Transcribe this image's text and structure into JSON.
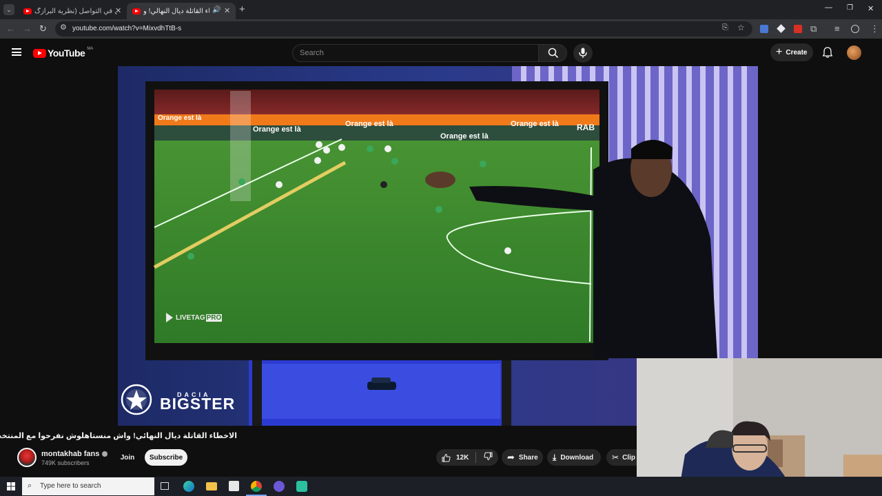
{
  "browser": {
    "tabs": [
      {
        "title": "مشكل في التواصل (نظرية البرازگ...",
        "active": false
      },
      {
        "title": "الاخطاء القاتلة ديال النهالي! و...",
        "active": true
      }
    ],
    "new_tab_label": "+",
    "url": "youtube.com/watch?v=MixvdhTtB-s",
    "window_controls": {
      "minimize": "—",
      "restore": "❐",
      "close": "✕"
    }
  },
  "youtube": {
    "logo_text": "YouTube",
    "region": "MA",
    "search_placeholder": "Search",
    "create_label": "Create"
  },
  "video": {
    "stadium_ads": [
      "Orange est là",
      "Orange est là",
      "Orange est là",
      "Orange est là",
      "Orange est là"
    ],
    "ad_short": "RAB",
    "watermark": "LIVETAG",
    "watermark_suffix": "PRO",
    "brand_small": "DACIA",
    "brand_big": "BIGSTER"
  },
  "info": {
    "title": "الاخطاء القاتلة ديال النهائي! واش منستاهلوش نفرحوا مع المنتخب فالكان؟",
    "channel_name": "montakhab fans",
    "subscribers": "749K subscribers",
    "join_label": "Join",
    "subscribe_label": "Subscribe",
    "like_count": "12K",
    "share_label": "Share",
    "download_label": "Download",
    "clip_label": "Clip"
  },
  "taskbar": {
    "search_placeholder": "Type here to search"
  },
  "colors": {
    "accent_red": "#ff0000",
    "pitch_green": "#3f8f2f",
    "bg": "#0f0f0f"
  }
}
